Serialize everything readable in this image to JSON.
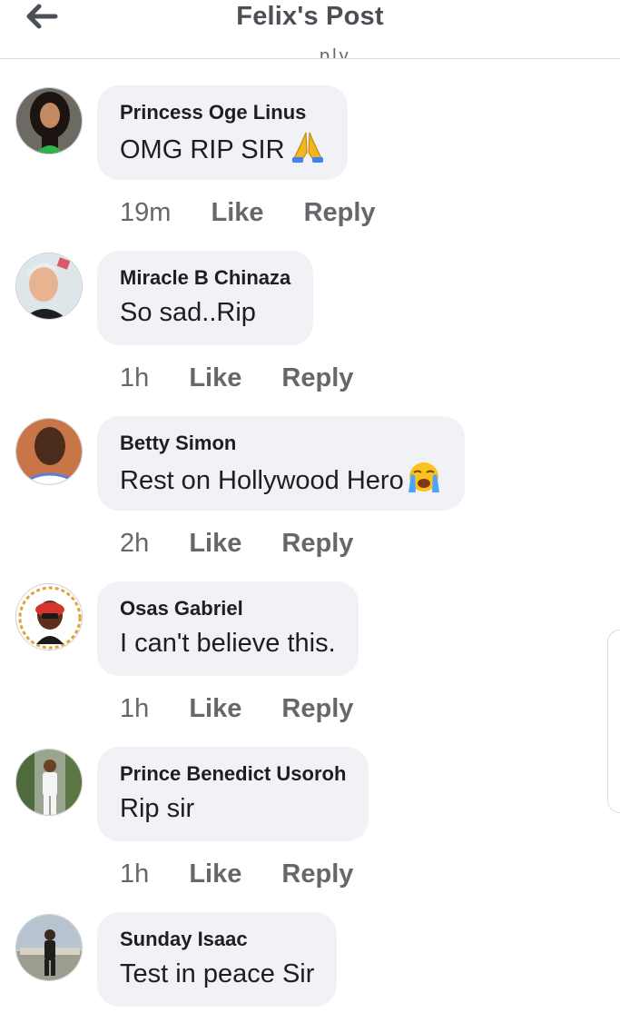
{
  "header": {
    "title": "Felix's Post",
    "back_icon": "arrow-left-icon"
  },
  "partial_text": "ply",
  "comments": [
    {
      "author": "Princess Oge Linus",
      "text": "OMG RIP SIR",
      "emoji": "folded-hands-emoji",
      "time": "19m",
      "like_label": "Like",
      "reply_label": "Reply"
    },
    {
      "author": "Miracle B Chinaza",
      "text": "So sad..Rip",
      "time": "1h",
      "like_label": "Like",
      "reply_label": "Reply"
    },
    {
      "author": "Betty Simon",
      "text": "Rest on Hollywood Hero",
      "emoji": "loudly-crying-face-emoji",
      "time": "2h",
      "like_label": "Like",
      "reply_label": "Reply"
    },
    {
      "author": "Osas Gabriel",
      "text": "I can't believe this.",
      "time": "1h",
      "like_label": "Like",
      "reply_label": "Reply"
    },
    {
      "author": "Prince Benedict Usoroh",
      "text": "Rip sir",
      "time": "1h",
      "like_label": "Like",
      "reply_label": "Reply"
    },
    {
      "author": "Sunday Isaac",
      "text": "Test in peace Sir"
    }
  ],
  "colors": {
    "bubble": "#f0f2f5",
    "meta": "#65676b",
    "title": "#4b4f56",
    "text": "#1c1e21"
  }
}
